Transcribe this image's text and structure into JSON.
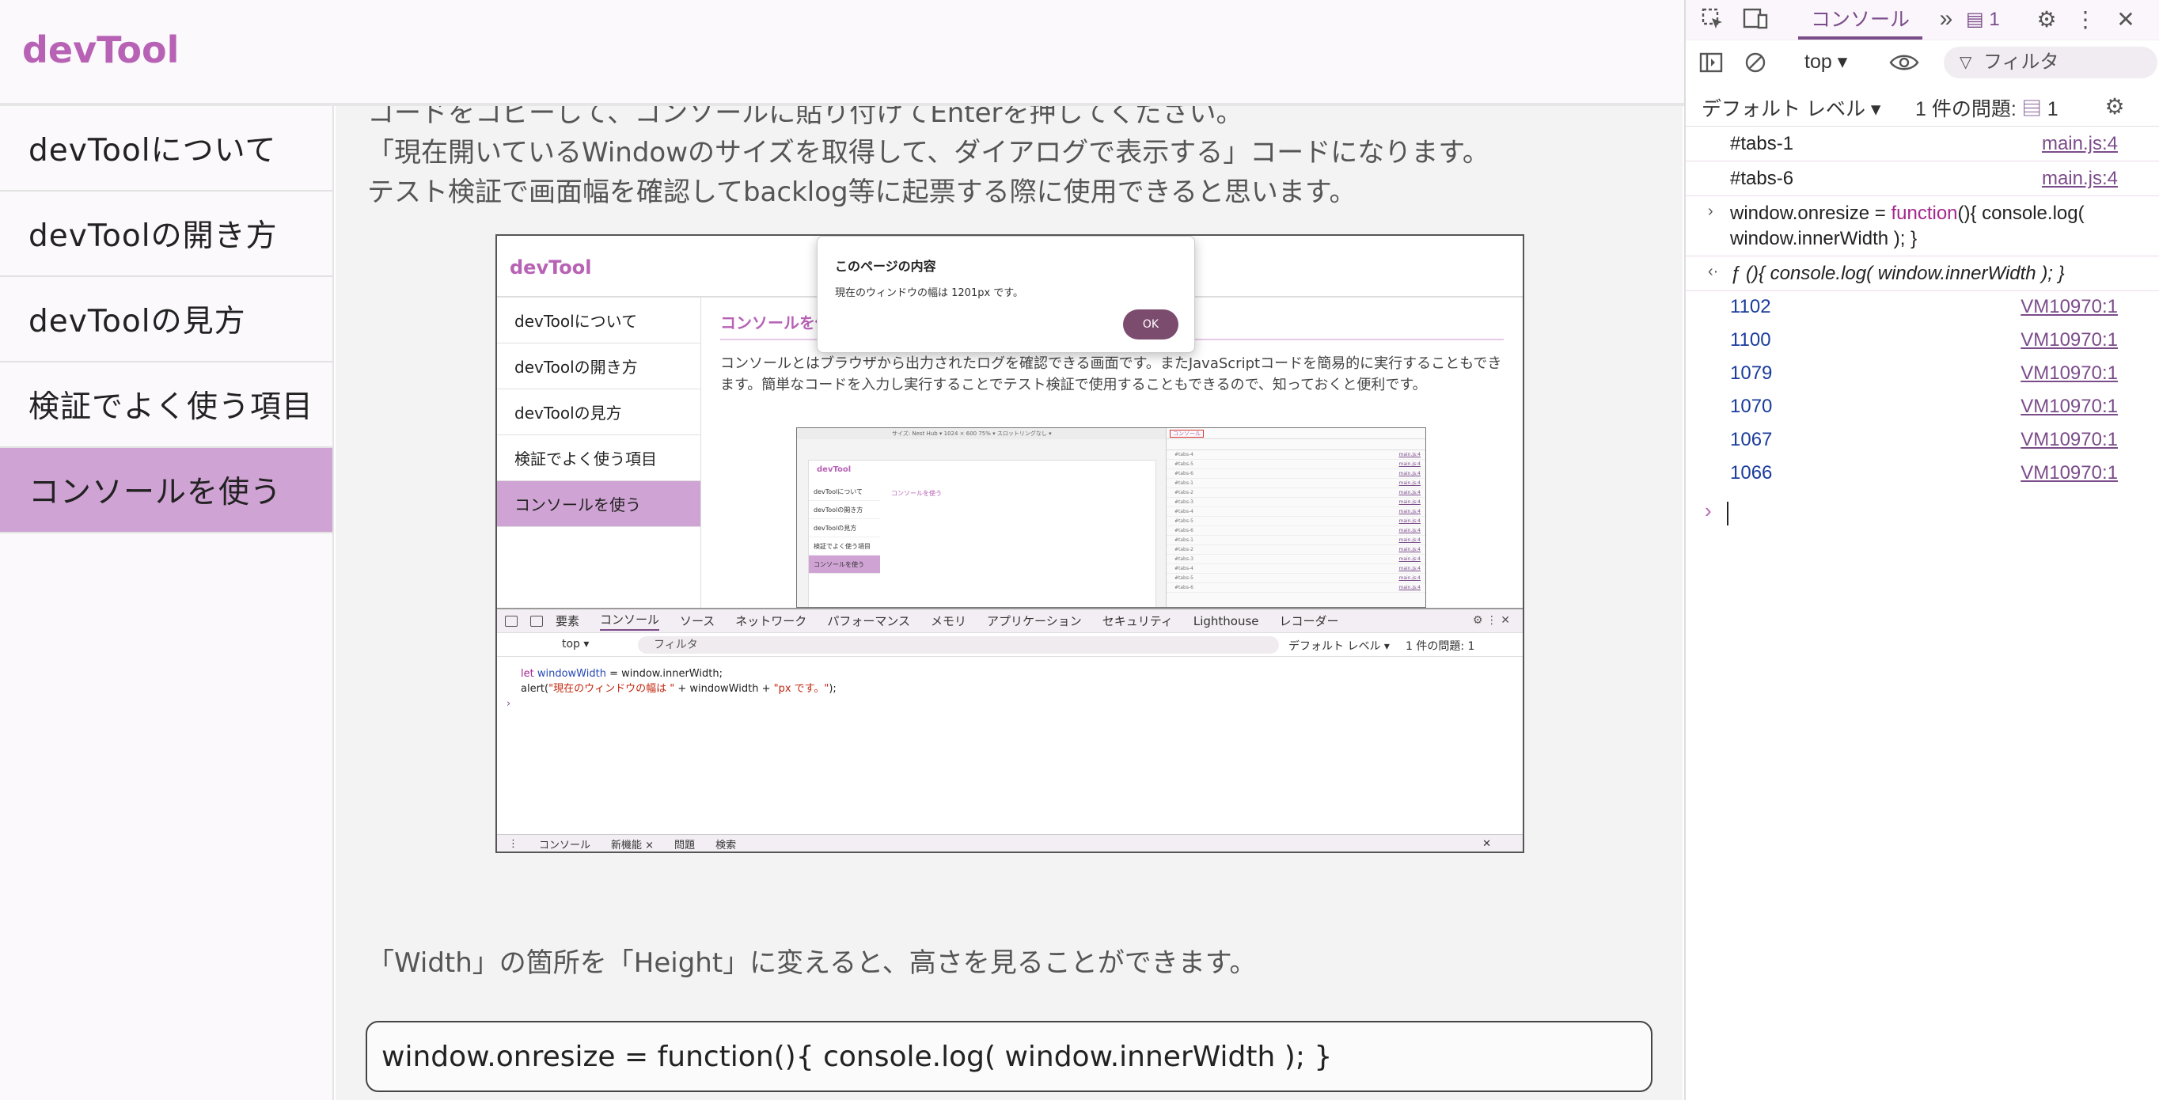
{
  "site": {
    "logo": "devTool",
    "sidebar": [
      {
        "label": "devToolについて"
      },
      {
        "label": "devToolの開き方"
      },
      {
        "label": "devToolの見方"
      },
      {
        "label": "検証でよく使う項目"
      },
      {
        "label": "コンソールを使う",
        "active": true
      }
    ]
  },
  "content": {
    "para_lines": [
      "コードをコピーして、コンソールに貼り付けてEnterを押してください。",
      "「現在開いているWindowのサイズを取得して、ダイアログで表示する」コードになります。",
      "テスト検証で画面幅を確認してbacklog等に起票する際に使用できると思います。"
    ],
    "width_note": "「Width」の箇所を「Height」に変えると、高さを見ることができます。",
    "code": "window.onresize = function(){ console.log( window.innerWidth ); }"
  },
  "screenshot": {
    "logo": "devTool",
    "sidebar": [
      "devToolについて",
      "devToolの開き方",
      "devToolの見方",
      "検証でよく使う項目",
      "コンソールを使う"
    ],
    "title": "コンソールを使う",
    "para": "コンソールとはブラウザから出力されたログを確認できる画面です。またJavaScriptコードを簡易的に実行することもできます。簡単なコードを入力し実行することでテスト検証で使用することもできるので、知っておくと便利です。",
    "dialog": {
      "title": "このページの内容",
      "message": "現在のウィンドウの幅は 1201px です。",
      "ok": "OK"
    },
    "nested": {
      "topbar": "サイズ: Nest Hub ▾    1024  ×  600    75% ▾   スロットリングなし ▾",
      "logo": "devTool",
      "sidebar": [
        "devToolについて",
        "devToolの開き方",
        "devToolの見方",
        "検証でよく使う項目",
        "コンソールを使う"
      ],
      "main_title": "コンソールを使う",
      "dt_tab": "コンソール",
      "rows": [
        "#tabs-4",
        "#tabs-5",
        "#tabs-6",
        "#tabs-1",
        "#tabs-2",
        "#tabs-3",
        "#tabs-4",
        "#tabs-5",
        "#tabs-6",
        "#tabs-1",
        "#tabs-2",
        "#tabs-3",
        "#tabs-4",
        "#tabs-5",
        "#tabs-6"
      ],
      "row_src": "main.js:4"
    },
    "devtools": {
      "tabs": [
        "要素",
        "コンソール",
        "ソース",
        "ネットワーク",
        "パフォーマンス",
        "メモリ",
        "アプリケーション",
        "セキュリティ",
        "Lighthouse",
        "レコーダー"
      ],
      "badge": "1",
      "top": "top ▾",
      "filter": "フィルタ",
      "level": "デフォルト レベル ▾",
      "issues": "1 件の問題: 1",
      "code_line1_kw": "let",
      "code_line1_var": "windowWidth",
      "code_line1_rest": " = window.innerWidth;",
      "code_line2_start": "alert(",
      "code_line2_str1": "\"現在のウィンドウの幅は \"",
      "code_line2_mid": " + windowWidth + ",
      "code_line2_str2": "\"px です。\"",
      "code_line2_end": ");",
      "drawer": [
        "コンソール",
        "新機能 ×",
        "問題",
        "検索"
      ]
    }
  },
  "devtools": {
    "console_tab": "コンソール",
    "issues_badge": "1",
    "context": "top",
    "filter_placeholder": "フィルタ",
    "level": "デフォルト レベル",
    "issues_label": "1 件の問題:",
    "issues_count": "1",
    "logs": [
      {
        "text": "#tabs-1",
        "src": "main.js:4"
      },
      {
        "text": "#tabs-6",
        "src": "main.js:4"
      }
    ],
    "input_line1_a": "window.onresize = ",
    "input_line1_kw": "function",
    "input_line1_b": "(){ console.log(",
    "input_line2": "window.innerWidth ); }",
    "return_value": "ƒ (){ console.log( window.innerWidth ); }",
    "numbers": [
      {
        "value": "1102",
        "src": "VM10970:1"
      },
      {
        "value": "1100",
        "src": "VM10970:1"
      },
      {
        "value": "1079",
        "src": "VM10970:1"
      },
      {
        "value": "1070",
        "src": "VM10970:1"
      },
      {
        "value": "1067",
        "src": "VM10970:1"
      },
      {
        "value": "1066",
        "src": "VM10970:1"
      }
    ]
  }
}
